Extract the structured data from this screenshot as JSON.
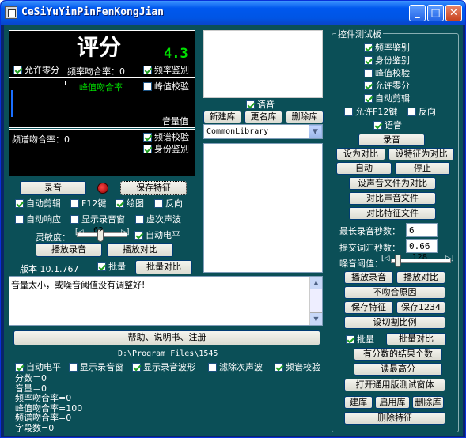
{
  "window": {
    "title": "CeSiYuYinPinFenKongJian",
    "min": "_",
    "max": "□",
    "close": "✕"
  },
  "score_panel": {
    "title": "评分",
    "score": "4.3",
    "allow_zero": "允许零分",
    "freq_match": "频率吻合率：0",
    "freq_auth": "频率鉴别",
    "peak_match": "峰值吻合率",
    "peak_check": "峰值校验",
    "volume": "音量值",
    "spectrum_match": "频谱吻合率：0",
    "spectrum_check": "频谱校验",
    "identity_auth": "身份鉴别"
  },
  "controls": {
    "record": "录音",
    "save_feature": "保存特征",
    "auto_clip": "自动剪辑",
    "f12": "F12键",
    "plot": "绘图",
    "reverse": "反向",
    "auto_respond": "自动响应",
    "show_record_window": "显示录音窗",
    "virtual_wave": "虚次声波",
    "sensitivity": "灵敏度：",
    "sensitivity_value": "62",
    "auto_level": "自动电平",
    "play_record": "播放录音",
    "play_compare": "播放对比",
    "version": "版本 10.1.767",
    "batch": "批量",
    "batch_compare": "批量对比"
  },
  "library": {
    "voice": "语音",
    "new": "新建库",
    "rename": "更名库",
    "delete": "删除库",
    "selected": "CommonLibrary"
  },
  "message": "音量太小，或噪音阈值没有调整好!",
  "help": "帮助、说明书、注册",
  "path": "D:\\Program Files\\1545",
  "bottom_checks": {
    "auto_level": "自动电平",
    "show_record_window": "显示录音窗",
    "show_waveform": "显示录音波形",
    "filter_infra": "滤除次声波",
    "spectrum_check": "频谱校验"
  },
  "stats": [
    "分数＝0",
    "音量＝0",
    "频率吻合率=0",
    "峰值吻合率=100",
    "频谱吻合率=0",
    "字段数=0"
  ],
  "test_panel": {
    "title": "控件测试板",
    "checks": [
      "频率鉴别",
      "身份鉴别",
      "峰值校验",
      "允许零分",
      "自动剪辑"
    ],
    "allow_f12": "允许F12键",
    "reverse": "反向",
    "voice": "语音",
    "record": "录音",
    "set_compare": "设为对比",
    "set_feature_compare": "设特征为对比",
    "auto": "自动",
    "stop": "停止",
    "set_file_compare": "设声音文件为对比",
    "compare_file": "对比声音文件",
    "compare_feature_file": "对比特征文件",
    "max_rec_label": "最长录音秒数：",
    "max_rec_value": "6",
    "submit_label": "提交词汇秒数：",
    "submit_value": "0.66",
    "noise_label": "噪音阈值：",
    "noise_value": "128",
    "play_record": "播放录音",
    "play_compare": "播放对比",
    "mismatch": "不吻合原因",
    "save_feature": "保存特征",
    "save_1234": "保存1234",
    "set_ratio": "设切割比例",
    "batch": "批量",
    "batch_compare": "批量对比",
    "score_count": "有分数的结果个数",
    "read_top": "读最高分",
    "open_generic": "打开通用版测试窗体",
    "build_lib": "建库",
    "enable_lib": "启用库",
    "delete_lib": "删除库",
    "delete_feature": "删除特征"
  }
}
